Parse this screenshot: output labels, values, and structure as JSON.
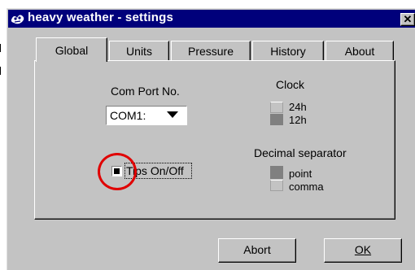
{
  "window": {
    "title": "heavy weather - settings",
    "close_glyph": "✕"
  },
  "tabs": [
    "Global",
    "Units",
    "Pressure",
    "History",
    "About"
  ],
  "global": {
    "com_port_label": "Com Port No.",
    "com_port_value": "COM1:",
    "clock_label": "Clock",
    "clock_options": [
      "24h",
      "12h"
    ],
    "clock_selected": "12h",
    "decimal_label": "Decimal separator",
    "decimal_options": [
      "point",
      "comma"
    ],
    "decimal_selected": "point",
    "tips_label": "Tips On/Off",
    "tips_checked": true
  },
  "buttons": {
    "abort": "Abort",
    "ok": "OK"
  },
  "colors": {
    "titlebar": "#00007b",
    "face": "#c3c3c3",
    "highlight_circle": "#e00000"
  },
  "icons": {
    "app": "weather-app-icon",
    "close": "close-icon",
    "dropdown": "chevron-down-icon"
  }
}
